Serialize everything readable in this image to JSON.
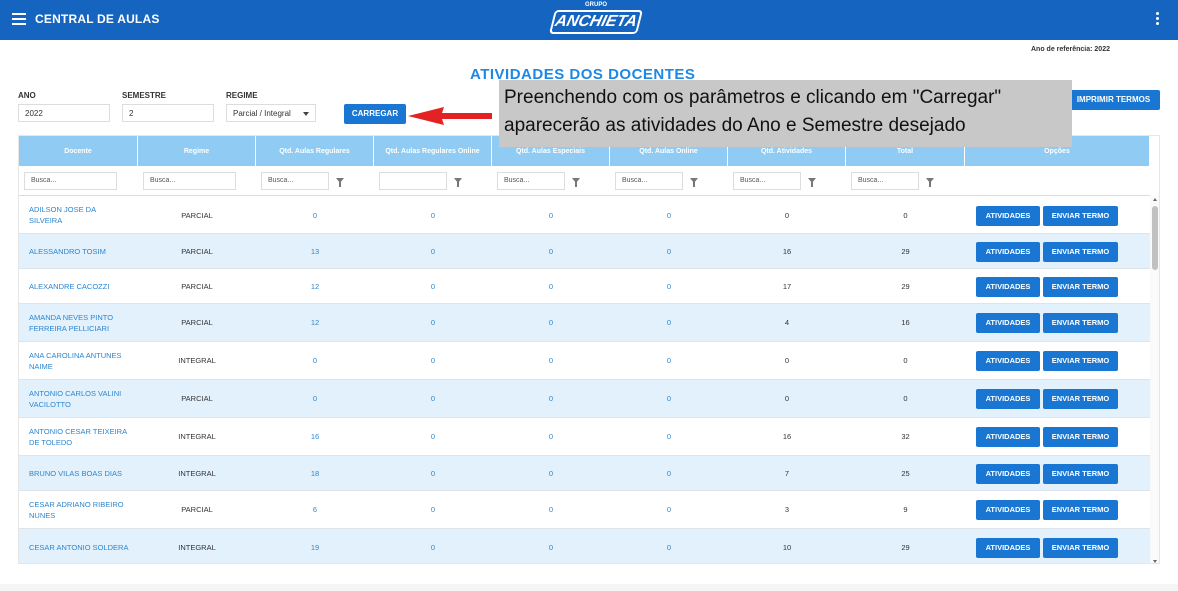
{
  "header": {
    "app_title": "CENTRAL DE AULAS",
    "logo_group": "GRUPO",
    "logo_name": "ANCHIETA",
    "menu_icon": "hamburger-icon",
    "more_icon": "kebab-icon"
  },
  "reference_year": "Ano de referência: 2022",
  "page_title": "ATIVIDADES DOS DOCENTES",
  "filters": {
    "ano_label": "ANO",
    "ano_value": "2022",
    "semestre_label": "SEMESTRE",
    "semestre_value": "2",
    "regime_label": "REGIME",
    "regime_value": "Parcial / Integral",
    "load_button": "CARREGAR",
    "print_button": "IMPRIMIR TERMOS"
  },
  "annotation": "Preenchendo com os parâmetros e clicando em \"Carregar\" aparecerão as atividades do Ano e Semestre desejado",
  "colors": {
    "primary": "#1565c0",
    "button": "#1976d2",
    "header_row": "#8fcbf2",
    "alt_row": "#e3f1fc",
    "link": "#2c86d0"
  },
  "table": {
    "columns": [
      "Docente",
      "Regime",
      "Qtd. Aulas Regulares",
      "Qtd. Aulas Regulares Online",
      "Qtd. Aulas Especiais",
      "Qtd. Aulas Online",
      "Qtd. Atividades",
      "Total",
      "Opções"
    ],
    "filter_placeholder": "Busca...",
    "action_buttons": [
      "ATIVIDADES",
      "ENVIAR TERMO"
    ],
    "rows": [
      {
        "docente": "ADILSON JOSE DA SILVEIRA",
        "regime": "PARCIAL",
        "regulares": "0",
        "reg_online": "0",
        "especiais": "0",
        "online": "0",
        "atividades": "0",
        "total": "0"
      },
      {
        "docente": "ALESSANDRO TOSIM",
        "regime": "PARCIAL",
        "regulares": "13",
        "reg_online": "0",
        "especiais": "0",
        "online": "0",
        "atividades": "16",
        "total": "29"
      },
      {
        "docente": "ALEXANDRE CACOZZI",
        "regime": "PARCIAL",
        "regulares": "12",
        "reg_online": "0",
        "especiais": "0",
        "online": "0",
        "atividades": "17",
        "total": "29"
      },
      {
        "docente": "AMANDA NEVES PINTO FERREIRA PELLICIARI",
        "regime": "PARCIAL",
        "regulares": "12",
        "reg_online": "0",
        "especiais": "0",
        "online": "0",
        "atividades": "4",
        "total": "16"
      },
      {
        "docente": "ANA CAROLINA ANTUNES NAIME",
        "regime": "INTEGRAL",
        "regulares": "0",
        "reg_online": "0",
        "especiais": "0",
        "online": "0",
        "atividades": "0",
        "total": "0"
      },
      {
        "docente": "ANTONIO CARLOS VALINI VACILOTTO",
        "regime": "PARCIAL",
        "regulares": "0",
        "reg_online": "0",
        "especiais": "0",
        "online": "0",
        "atividades": "0",
        "total": "0"
      },
      {
        "docente": "ANTONIO CESAR TEIXEIRA DE TOLEDO",
        "regime": "INTEGRAL",
        "regulares": "16",
        "reg_online": "0",
        "especiais": "0",
        "online": "0",
        "atividades": "16",
        "total": "32"
      },
      {
        "docente": "BRUNO VILAS BOAS DIAS",
        "regime": "INTEGRAL",
        "regulares": "18",
        "reg_online": "0",
        "especiais": "0",
        "online": "0",
        "atividades": "7",
        "total": "25"
      },
      {
        "docente": "CESAR ADRIANO RIBEIRO NUNES",
        "regime": "PARCIAL",
        "regulares": "6",
        "reg_online": "0",
        "especiais": "0",
        "online": "0",
        "atividades": "3",
        "total": "9"
      },
      {
        "docente": "CESAR ANTONIO SOLDERA",
        "regime": "INTEGRAL",
        "regulares": "19",
        "reg_online": "0",
        "especiais": "0",
        "online": "0",
        "atividades": "10",
        "total": "29"
      }
    ]
  }
}
